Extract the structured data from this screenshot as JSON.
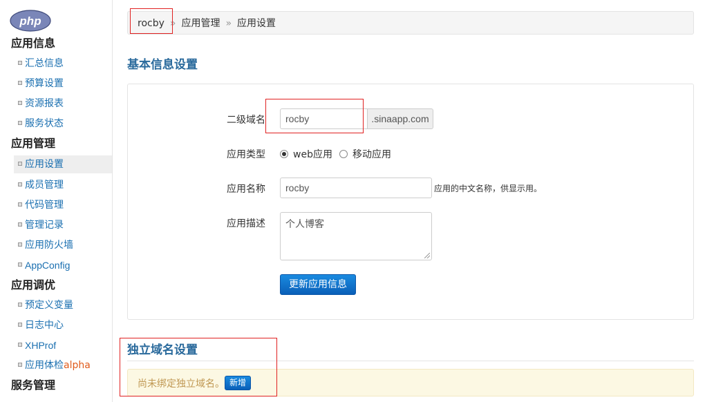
{
  "logo": {
    "text": "php"
  },
  "sidebar": {
    "groups": [
      {
        "title": "应用信息",
        "items": [
          "汇总信息",
          "预算设置",
          "资源报表",
          "服务状态"
        ]
      },
      {
        "title": "应用管理",
        "items": [
          "应用设置",
          "成员管理",
          "代码管理",
          "管理记录",
          "应用防火墙",
          "AppConfig"
        ]
      },
      {
        "title": "应用调优",
        "items": [
          "预定义变量",
          "日志中心",
          "XHProf",
          "应用体检"
        ],
        "alpha_badge": "alpha"
      },
      {
        "title": "服务管理"
      }
    ]
  },
  "breadcrumb": {
    "items": [
      "rocby",
      "应用管理",
      "应用设置"
    ],
    "separator": "»"
  },
  "basic_info": {
    "title": "基本信息设置",
    "subdomain": {
      "label": "二级域名",
      "value": "rocby",
      "suffix": ".sinaapp.com"
    },
    "app_type": {
      "label": "应用类型",
      "options": [
        "web应用",
        "移动应用"
      ],
      "selected": "web应用"
    },
    "app_name": {
      "label": "应用名称",
      "value": "rocby",
      "hint": "应用的中文名称，供显示用。"
    },
    "app_desc": {
      "label": "应用描述",
      "value": "个人博客"
    },
    "submit_label": "更新应用信息"
  },
  "custom_domain": {
    "title": "独立域名设置",
    "empty_text": "尚未绑定独立域名。",
    "add_label": "新增"
  },
  "colors": {
    "accent": "#2a6a9c",
    "link": "#1a6fb0",
    "highlight_border": "#e02020",
    "alert_bg": "#fcf8e3"
  }
}
